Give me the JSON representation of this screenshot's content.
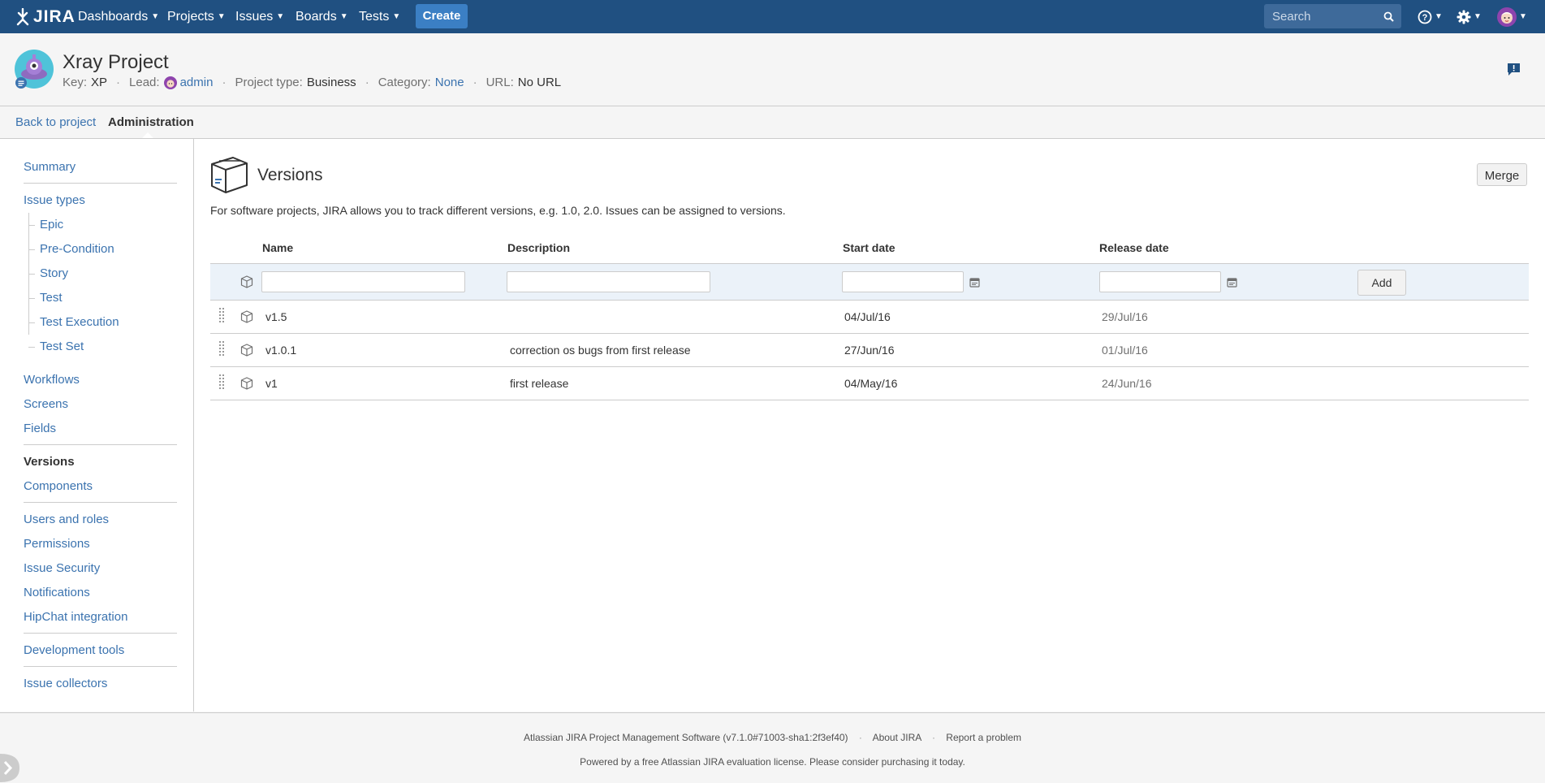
{
  "topnav": {
    "logo_text": "JIRA",
    "menu": [
      {
        "label": "Dashboards"
      },
      {
        "label": "Projects"
      },
      {
        "label": "Issues"
      },
      {
        "label": "Boards"
      },
      {
        "label": "Tests"
      }
    ],
    "create_label": "Create",
    "search_placeholder": "Search"
  },
  "project": {
    "name": "Xray Project",
    "key_label": "Key:",
    "key": "XP",
    "lead_label": "Lead:",
    "lead": "admin",
    "type_label": "Project type:",
    "type": "Business",
    "category_label": "Category:",
    "category": "None",
    "url_label": "URL:",
    "url": "No URL"
  },
  "subnav": {
    "back": "Back to project",
    "current": "Administration"
  },
  "sidebar": {
    "summary": "Summary",
    "issue_types": "Issue types",
    "issue_type_children": [
      "Epic",
      "Pre-Condition",
      "Story",
      "Test",
      "Test Execution",
      "Test Set"
    ],
    "workflows": "Workflows",
    "screens": "Screens",
    "fields": "Fields",
    "versions": "Versions",
    "components": "Components",
    "users_roles": "Users and roles",
    "permissions": "Permissions",
    "issue_security": "Issue Security",
    "notifications": "Notifications",
    "hipchat": "HipChat integration",
    "dev_tools": "Development tools",
    "issue_collectors": "Issue collectors"
  },
  "main": {
    "title": "Versions",
    "merge_label": "Merge",
    "description": "For software projects, JIRA allows you to track different versions, e.g. 1.0, 2.0. Issues can be assigned to versions.",
    "columns": {
      "name": "Name",
      "description": "Description",
      "start": "Start date",
      "release": "Release date"
    },
    "add_label": "Add",
    "versions": [
      {
        "name": "v1.5",
        "description": "",
        "start": "04/Jul/16",
        "release": "29/Jul/16"
      },
      {
        "name": "v1.0.1",
        "description": "correction os bugs from first release",
        "start": "27/Jun/16",
        "release": "01/Jul/16"
      },
      {
        "name": "v1",
        "description": "first release",
        "start": "04/May/16",
        "release": "24/Jun/16"
      }
    ]
  },
  "footer": {
    "software": "Atlassian JIRA Project Management Software (v7.1.0#71003-sha1:2f3ef40)",
    "about": "About JIRA",
    "report": "Report a problem",
    "license": "Powered by a free Atlassian JIRA evaluation license. Please consider purchasing it today."
  }
}
